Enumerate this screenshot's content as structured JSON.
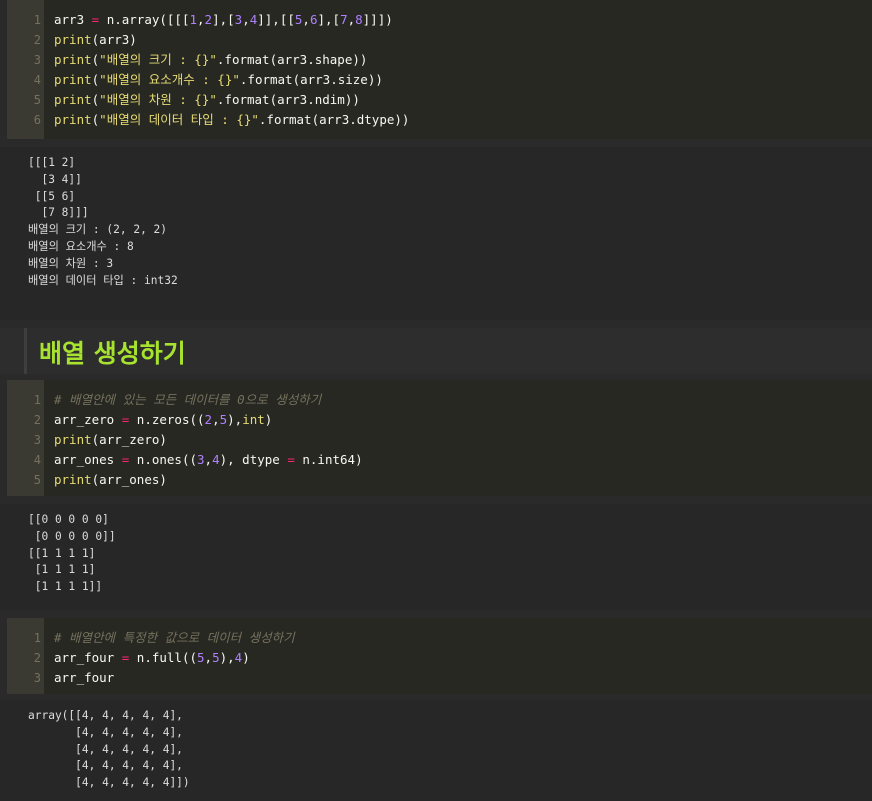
{
  "cell1": {
    "line_numbers": [
      "1",
      "2",
      "3",
      "4",
      "5",
      "6"
    ],
    "output": [
      "[[[1 2]",
      "  [3 4]]",
      "",
      " [[5 6]",
      "  [7 8]]]",
      "배열의 크기 : (2, 2, 2)",
      "배열의 요소개수 : 8",
      "배열의 차원 : 3",
      "배열의 데이터 타입 : int32"
    ]
  },
  "heading": {
    "title": "배열 생성하기"
  },
  "cell2": {
    "line_numbers": [
      "1",
      "2",
      "3",
      "4",
      "5"
    ],
    "comment": "# 배열안에 있는 모든 데이터를 0으로 생성하기",
    "output": [
      "[[0 0 0 0 0]",
      " [0 0 0 0 0]]",
      "[[1 1 1 1]",
      " [1 1 1 1]",
      " [1 1 1 1]]"
    ]
  },
  "cell3": {
    "line_numbers": [
      "1",
      "2",
      "3"
    ],
    "comment": "# 배열안에 특정한 값으로 데이터 생성하기",
    "output": [
      "array([[4, 4, 4, 4, 4],",
      "       [4, 4, 4, 4, 4],",
      "       [4, 4, 4, 4, 4],",
      "       [4, 4, 4, 4, 4],",
      "       [4, 4, 4, 4, 4]])"
    ]
  },
  "colors": {
    "code_bg": "#272822",
    "gutter_bg": "#3b3a32",
    "keyword": "#e6db74",
    "operator": "#f92672",
    "number": "#ae81ff",
    "builtin": "#66d9ef",
    "comment": "#75715e",
    "heading": "#a6e22e"
  }
}
